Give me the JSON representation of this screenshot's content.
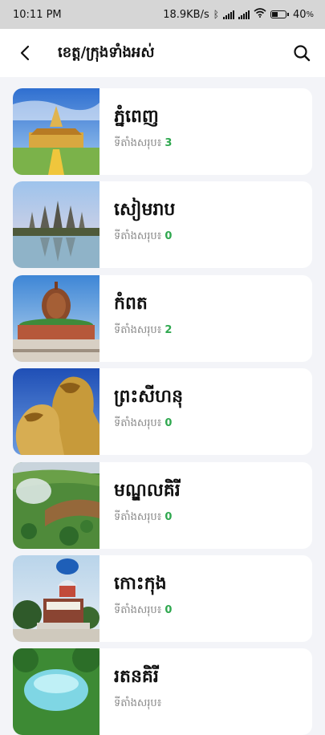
{
  "status": {
    "time": "10:11 PM",
    "speed": "18.9KB/s",
    "battery": "40"
  },
  "header": {
    "title": "ខេត្ត/ក្រុងទាំងអស់"
  },
  "provinces": [
    {
      "name": "ភ្នំពេញ",
      "count_label": "ទីតាំងសរុប៖",
      "count": "3"
    },
    {
      "name": "សៀមរាប",
      "count_label": "ទីតាំងសរុប៖",
      "count": "0"
    },
    {
      "name": "កំពត",
      "count_label": "ទីតាំងសរុប៖",
      "count": "2"
    },
    {
      "name": "ព្រះសីហនុ",
      "count_label": "ទីតាំងសរុប៖",
      "count": "0"
    },
    {
      "name": "មណ្ឌលគិរី",
      "count_label": "ទីតាំងសរុប៖",
      "count": "0"
    },
    {
      "name": "កោះកុង",
      "count_label": "ទីតាំងសរុប៖",
      "count": "0"
    },
    {
      "name": "រតនគិរី",
      "count_label": "ទីតាំងសរុប៖",
      "count": ""
    }
  ]
}
